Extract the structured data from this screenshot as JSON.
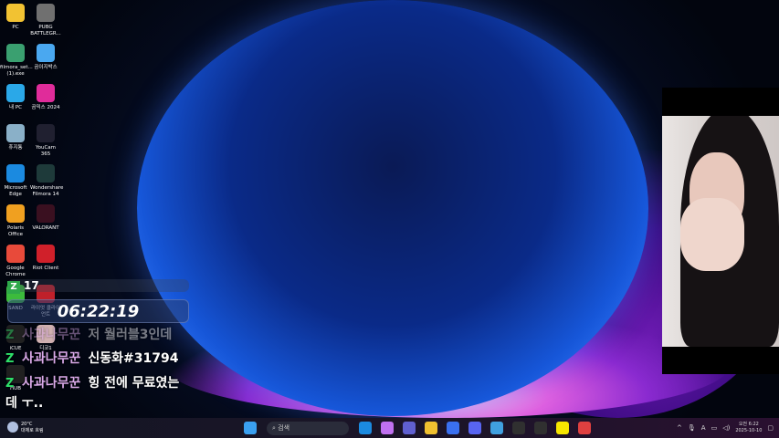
{
  "desktop_icons": [
    {
      "label": "PC",
      "color": "#f2c232"
    },
    {
      "label": "PUBG BATTLEGR...",
      "color": "#707070"
    },
    {
      "label": "filmora_set... (1).exe",
      "color": "#3aa070"
    },
    {
      "label": "곰이지박스",
      "color": "#4aa8f0"
    },
    {
      "label": "내 PC",
      "color": "#2aa8e8"
    },
    {
      "label": "곰믹스 2024",
      "color": "#e02c9a"
    },
    {
      "label": "휴지통",
      "color": "#8ab0c8"
    },
    {
      "label": "YouCam 365",
      "color": "#202030"
    },
    {
      "label": "Microsoft Edge",
      "color": "#1b8ae0"
    },
    {
      "label": "Wondershare Filmora 14",
      "color": "#1e3a3a"
    },
    {
      "label": "Polaris Office",
      "color": "#f0a020"
    },
    {
      "label": "VALORANT",
      "color": "#3a1020"
    },
    {
      "label": "Google Chrome",
      "color": "#e84a3a"
    },
    {
      "label": "Riot Client",
      "color": "#d0202a"
    },
    {
      "label": "SAND",
      "color": "#3cbb3c"
    },
    {
      "label": "라이엇 클라이언트",
      "color": "#c0202a"
    },
    {
      "label": "iCUE",
      "color": "#202020"
    },
    {
      "label": "디코1",
      "color": "#d0b0b0"
    },
    {
      "label": "HUB",
      "color": "#202020"
    }
  ],
  "overlay": {
    "viewer_count": "17",
    "clock": "06:22:19",
    "chat": [
      {
        "nick": "사과나무꾼",
        "msg": "저 월러블3인데",
        "faded": true
      },
      {
        "nick": "사과나무꾼",
        "msg": "신동화#31794",
        "faded": false
      },
      {
        "nick": "사과나무꾼",
        "msg": "힝 전에 무료였는",
        "faded": false
      }
    ],
    "chat_continuation": "데 ㅜ..",
    "chat_icon": "Z"
  },
  "taskbar": {
    "search_placeholder": "검색",
    "apps": [
      "start-icon",
      "edge-icon",
      "copilot-icon",
      "teams-icon",
      "file-explorer-icon",
      "media-player-icon",
      "discord-icon",
      "photos-icon",
      "obs-icon",
      "g-hub-icon",
      "kakaotalk-icon",
      "chrome-icon"
    ],
    "app_colors": [
      "#3aa0f0",
      "#1b8ae0",
      "#c070f0",
      "#6060d0",
      "#f0c030",
      "#3a70f0",
      "#5865f2",
      "#40a0e0",
      "#303030",
      "#303030",
      "#f7e600",
      "#e04040"
    ],
    "weather_temp": "20°C",
    "weather_desc": "대체로 흐림",
    "tray": {
      "chevron": "^",
      "mic": "🎙",
      "ime": "A",
      "time": "오전 6:22",
      "date": "2025-10-10"
    }
  }
}
